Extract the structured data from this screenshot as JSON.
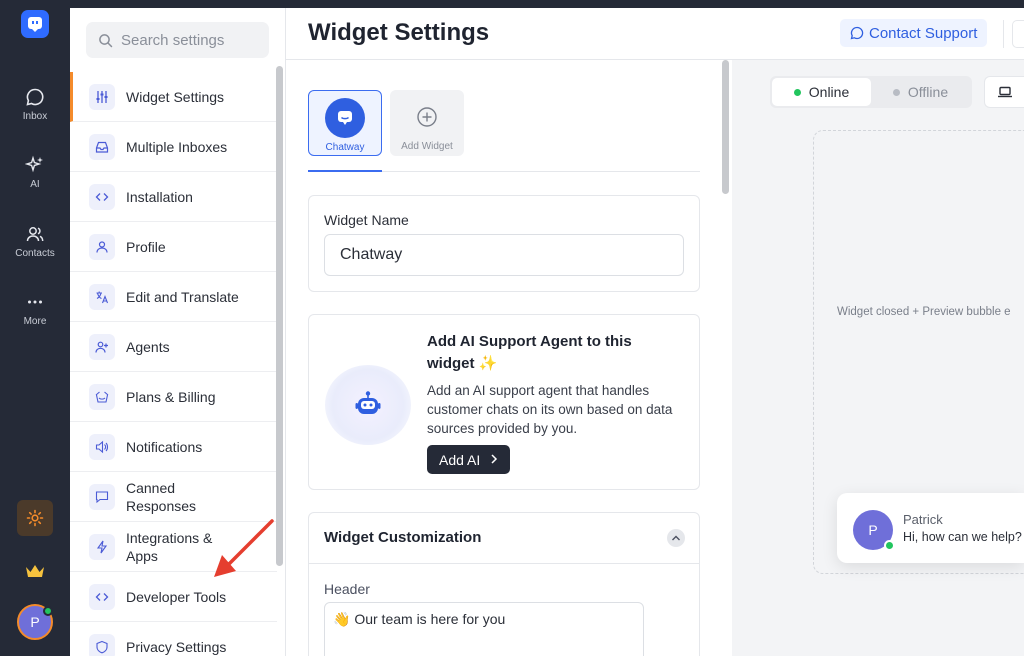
{
  "rail": {
    "items": [
      {
        "label": "Inbox",
        "icon": "chat-bubble-icon"
      },
      {
        "label": "AI",
        "icon": "sparkles-icon"
      },
      {
        "label": "Contacts",
        "icon": "users-icon"
      },
      {
        "label": "More",
        "icon": "ellipsis-icon"
      }
    ],
    "avatar_initial": "P",
    "accent": "#f48b2b"
  },
  "settings_nav": {
    "search_placeholder": "Search settings",
    "items": [
      {
        "label": "Widget Settings",
        "icon": "sliders-icon",
        "active": true
      },
      {
        "label": "Multiple Inboxes",
        "icon": "inbox-icon"
      },
      {
        "label": "Installation",
        "icon": "code-icon"
      },
      {
        "label": "Profile",
        "icon": "user-icon"
      },
      {
        "label": "Edit and Translate",
        "icon": "translate-icon"
      },
      {
        "label": "Agents",
        "icon": "user-plus-icon"
      },
      {
        "label": "Plans & Billing",
        "icon": "basket-icon"
      },
      {
        "label": "Notifications",
        "icon": "speaker-icon"
      },
      {
        "label": "Canned Responses",
        "icon": "message-square-icon"
      },
      {
        "label": "Integrations & Apps",
        "icon": "lightning-icon"
      },
      {
        "label": "Developer Tools",
        "icon": "code-icon"
      },
      {
        "label": "Privacy Settings",
        "icon": "shield-icon"
      }
    ]
  },
  "header": {
    "title": "Widget Settings",
    "support_label": "Contact Support"
  },
  "widgets": {
    "tabs": [
      {
        "label": "Chatway"
      },
      {
        "label": "Add Widget"
      }
    ]
  },
  "widget_name": {
    "label": "Widget Name",
    "value": "Chatway"
  },
  "ai_card": {
    "title": "Add AI Support Agent to this widget",
    "title_emoji": "✨",
    "description": "Add an AI support agent that handles customer chats on its own based on data sources provided by you.",
    "button_label": "Add AI"
  },
  "customization": {
    "title": "Widget Customization",
    "header_label": "Header",
    "header_value": "👋 Our team is here for you"
  },
  "preview": {
    "online_label": "Online",
    "offline_label": "Offline",
    "caption": "Widget closed + Preview bubble e",
    "agent_name": "Patrick",
    "agent_initial": "P",
    "agent_message": "Hi, how can we help?",
    "online_color": "#22c55e"
  }
}
